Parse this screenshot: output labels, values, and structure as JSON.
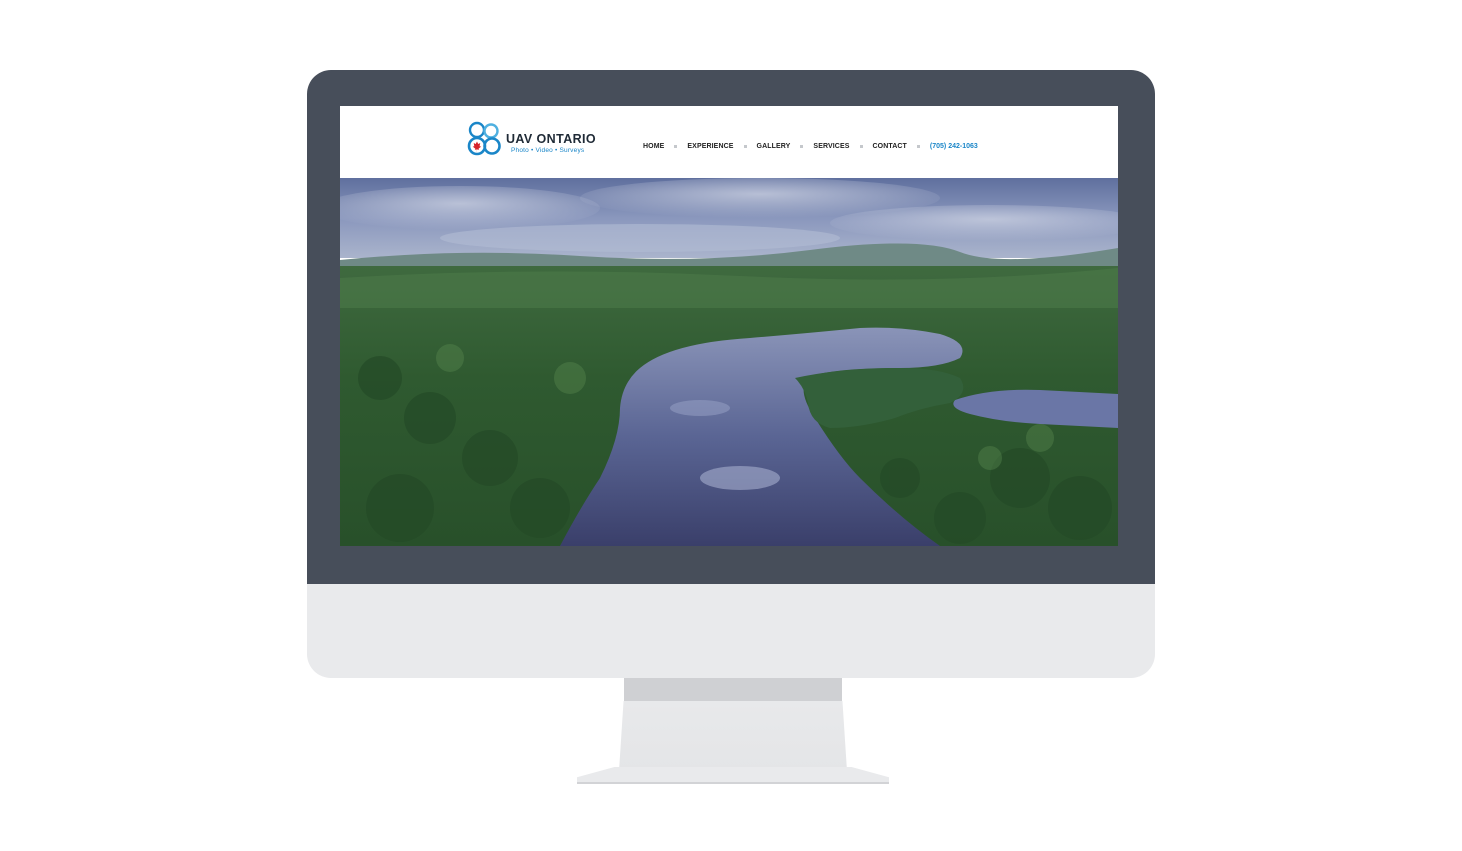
{
  "site": {
    "brand_name": "UAV ONTARIO",
    "brand_tagline": "Photo • Video • Surveys"
  },
  "nav": {
    "items": [
      {
        "label": "HOME"
      },
      {
        "label": "EXPERIENCE"
      },
      {
        "label": "GALLERY"
      },
      {
        "label": "SERVICES"
      },
      {
        "label": "CONTACT"
      }
    ],
    "phone": "(705) 242-1063"
  },
  "hero": {
    "image": "aerial-lake-forest-photo"
  },
  "colors": {
    "bezel": "#474e5a",
    "chin": "#e9eaec",
    "accent": "#1a86c8",
    "nav_text": "#222222"
  },
  "icons": {
    "logo": "uav-ontario-logo-icon",
    "separator": "nav-separator-dot"
  }
}
